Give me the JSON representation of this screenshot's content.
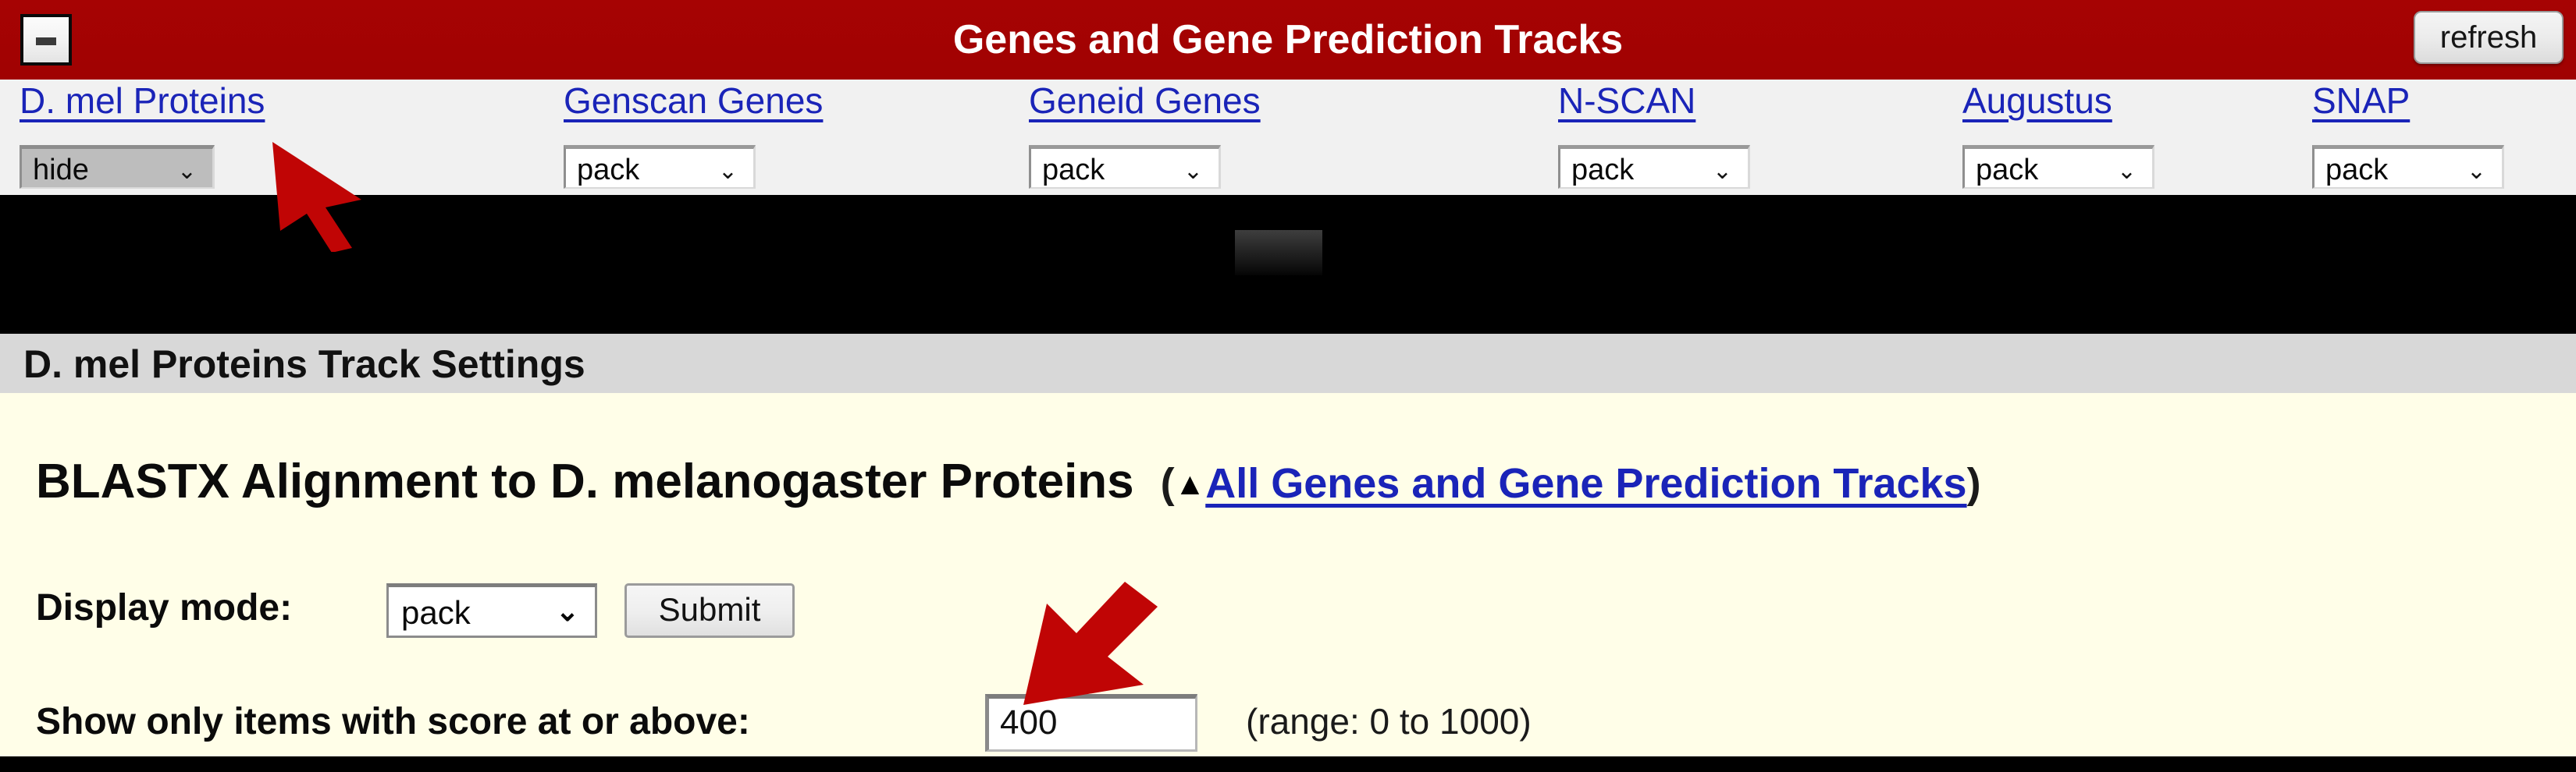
{
  "titlebar": {
    "title": "Genes and Gene Prediction Tracks",
    "minimize_label": "-",
    "refresh_label": "refresh",
    "bg_color": "#a60303",
    "text_color": "#ffffff"
  },
  "track_row": {
    "tracks": [
      {
        "label": "D. mel Proteins",
        "mode": "hide",
        "disabled": true
      },
      {
        "label": "Genscan Genes",
        "mode": "pack",
        "disabled": false
      },
      {
        "label": "Geneid Genes",
        "mode": "pack",
        "disabled": false
      },
      {
        "label": "N-SCAN",
        "mode": "pack",
        "disabled": false
      },
      {
        "label": "Augustus",
        "mode": "pack",
        "disabled": false
      },
      {
        "label": "SNAP",
        "mode": "pack",
        "disabled": false
      }
    ],
    "link_color": "#1a24b8"
  },
  "section": {
    "header": "D. mel Proteins Track Settings"
  },
  "main": {
    "heading_text": "BLASTX Alignment to D. melanogaster Proteins",
    "paren_open": "(",
    "up_triangle": "▲",
    "all_tracks_link": "All Genes and Gene Prediction Tracks",
    "paren_close": ")",
    "display_mode_label": "Display mode:",
    "display_mode_value": "pack",
    "submit_label": "Submit",
    "score_label": "Show only items with score at or above:",
    "score_value": "400",
    "range_note": "(range: 0 to 1000)",
    "select_arrow": "⌄"
  },
  "cursors": [
    {
      "name": "arrow-pointing-at-d-mel-proteins-select",
      "color": "#c00505"
    },
    {
      "name": "arrow-pointing-at-score-input",
      "color": "#c00505"
    }
  ]
}
